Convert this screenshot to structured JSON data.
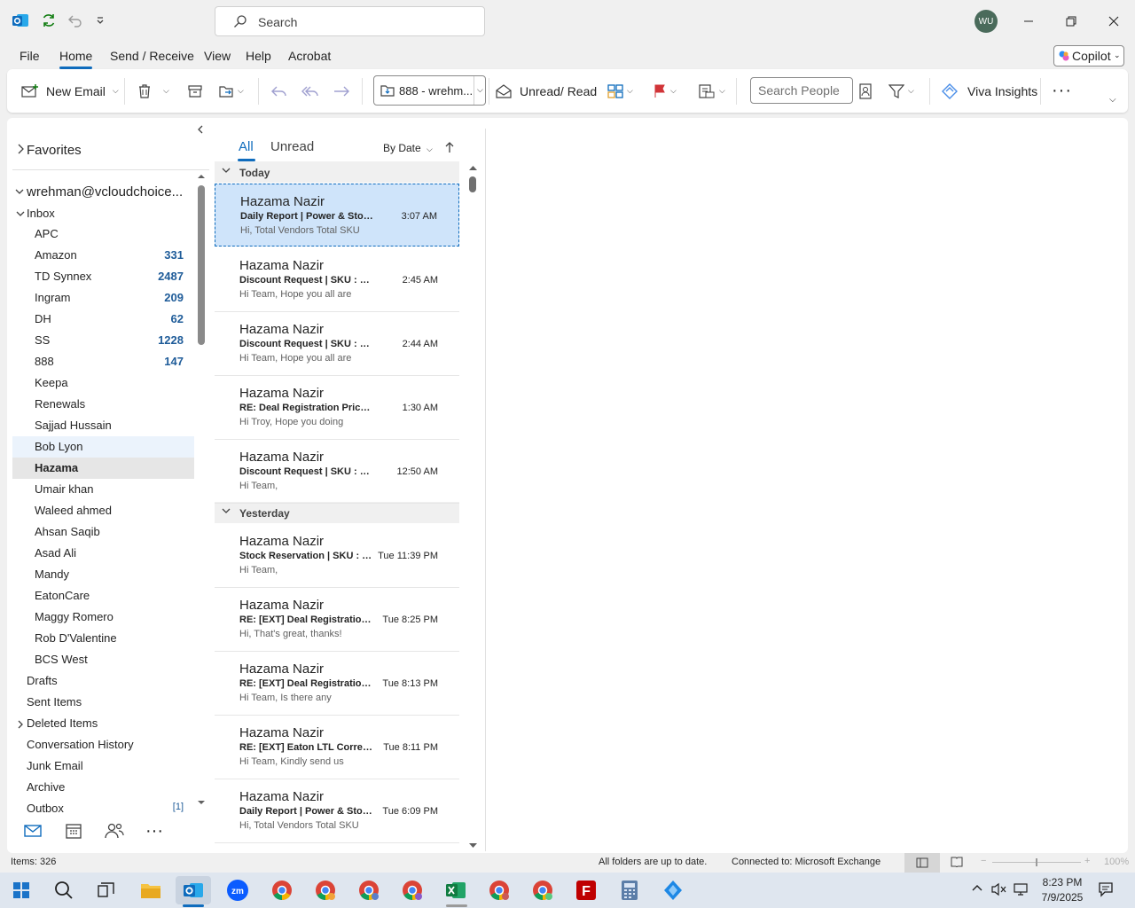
{
  "titlebar": {
    "search_placeholder": "Search",
    "avatar_initials": "WU"
  },
  "menu": {
    "file": "File",
    "home": "Home",
    "send_receive": "Send / Receive",
    "view": "View",
    "help": "Help",
    "acrobat": "Acrobat",
    "copilot": "Copilot"
  },
  "ribbon": {
    "new_email": "New Email",
    "move_target": "888 - wrehm...",
    "unread_read": "Unread/ Read",
    "search_people_placeholder": "Search People",
    "viva_insights": "Viva Insights"
  },
  "folders": {
    "favorites": "Favorites",
    "account": "wrehman@vcloudchoice...",
    "inbox": "Inbox",
    "subfolders": [
      {
        "label": "APC",
        "count": ""
      },
      {
        "label": "Amazon",
        "count": "331"
      },
      {
        "label": "TD Synnex",
        "count": "2487"
      },
      {
        "label": "Ingram",
        "count": "209"
      },
      {
        "label": "DH",
        "count": "62"
      },
      {
        "label": "SS",
        "count": "1228"
      },
      {
        "label": "888",
        "count": "147"
      },
      {
        "label": "Keepa",
        "count": ""
      },
      {
        "label": "Renewals",
        "count": ""
      },
      {
        "label": "Sajjad Hussain",
        "count": ""
      },
      {
        "label": "Bob Lyon",
        "count": ""
      },
      {
        "label": "Hazama",
        "count": ""
      },
      {
        "label": "Umair khan",
        "count": ""
      },
      {
        "label": "Waleed ahmed",
        "count": ""
      },
      {
        "label": "Ahsan Saqib",
        "count": ""
      },
      {
        "label": "Asad Ali",
        "count": ""
      },
      {
        "label": "Mandy",
        "count": ""
      },
      {
        "label": "EatonCare",
        "count": ""
      },
      {
        "label": "Maggy Romero",
        "count": ""
      },
      {
        "label": "Rob D'Valentine",
        "count": ""
      },
      {
        "label": "BCS West",
        "count": ""
      }
    ],
    "top_level": [
      {
        "label": "Drafts",
        "count": ""
      },
      {
        "label": "Sent Items",
        "count": ""
      },
      {
        "label": "Deleted Items",
        "count": ""
      },
      {
        "label": "Conversation History",
        "count": ""
      },
      {
        "label": "Junk Email",
        "count": ""
      },
      {
        "label": "Archive",
        "count": ""
      },
      {
        "label": "Outbox",
        "count": "[1]"
      }
    ]
  },
  "list": {
    "tab_all": "All",
    "tab_unread": "Unread",
    "sort": "By Date",
    "group_today": "Today",
    "group_yesterday": "Yesterday",
    "messages": [
      {
        "sender": "Hazama Nazir",
        "subject": "Daily Report | Power & Stor...",
        "time": "3:07 AM",
        "preview": "Hi,  Total Vendors  Total SKU"
      },
      {
        "sender": "Hazama Nazir",
        "subject": "Discount Request | SKU : S...",
        "time": "2:45 AM",
        "preview": "Hi Team,  Hope you all are"
      },
      {
        "sender": "Hazama Nazir",
        "subject": "Discount Request | SKU : S...",
        "time": "2:44 AM",
        "preview": "Hi Team,  Hope you all are"
      },
      {
        "sender": "Hazama Nazir",
        "subject": "RE: Deal Registration Pricin...",
        "time": "1:30 AM",
        "preview": "Hi Troy,  Hope you doing"
      },
      {
        "sender": "Hazama Nazir",
        "subject": "Discount Request | SKU : S...",
        "time": "12:50 AM",
        "preview": "Hi Team,"
      },
      {
        "sender": "Hazama Nazir",
        "subject": "Stock Reservation | SKU : S...",
        "time": "Tue 11:39 PM",
        "preview": "Hi Team,"
      },
      {
        "sender": "Hazama Nazir",
        "subject": "RE: [EXT] Deal Registration ...",
        "time": "Tue 8:25 PM",
        "preview": "Hi,  That's great, thanks!"
      },
      {
        "sender": "Hazama Nazir",
        "subject": "RE: [EXT] Deal Registration ...",
        "time": "Tue 8:13 PM",
        "preview": "Hi Team,  Is there any"
      },
      {
        "sender": "Hazama Nazir",
        "subject": "RE: [EXT] Eaton LTL Correcti...",
        "time": "Tue 8:11 PM",
        "preview": "Hi Team,  Kindly send us"
      },
      {
        "sender": "Hazama Nazir",
        "subject": "Daily Report | Power & Stor...",
        "time": "Tue 6:09 PM",
        "preview": "Hi,  Total Vendors  Total SKU"
      }
    ]
  },
  "status": {
    "items": "Items: 326",
    "sync": "All folders are up to date.",
    "connection": "Connected to: Microsoft Exchange",
    "zoom": "100%"
  },
  "taskbar": {
    "time": "8:23 PM",
    "date": "7/9/2025"
  }
}
